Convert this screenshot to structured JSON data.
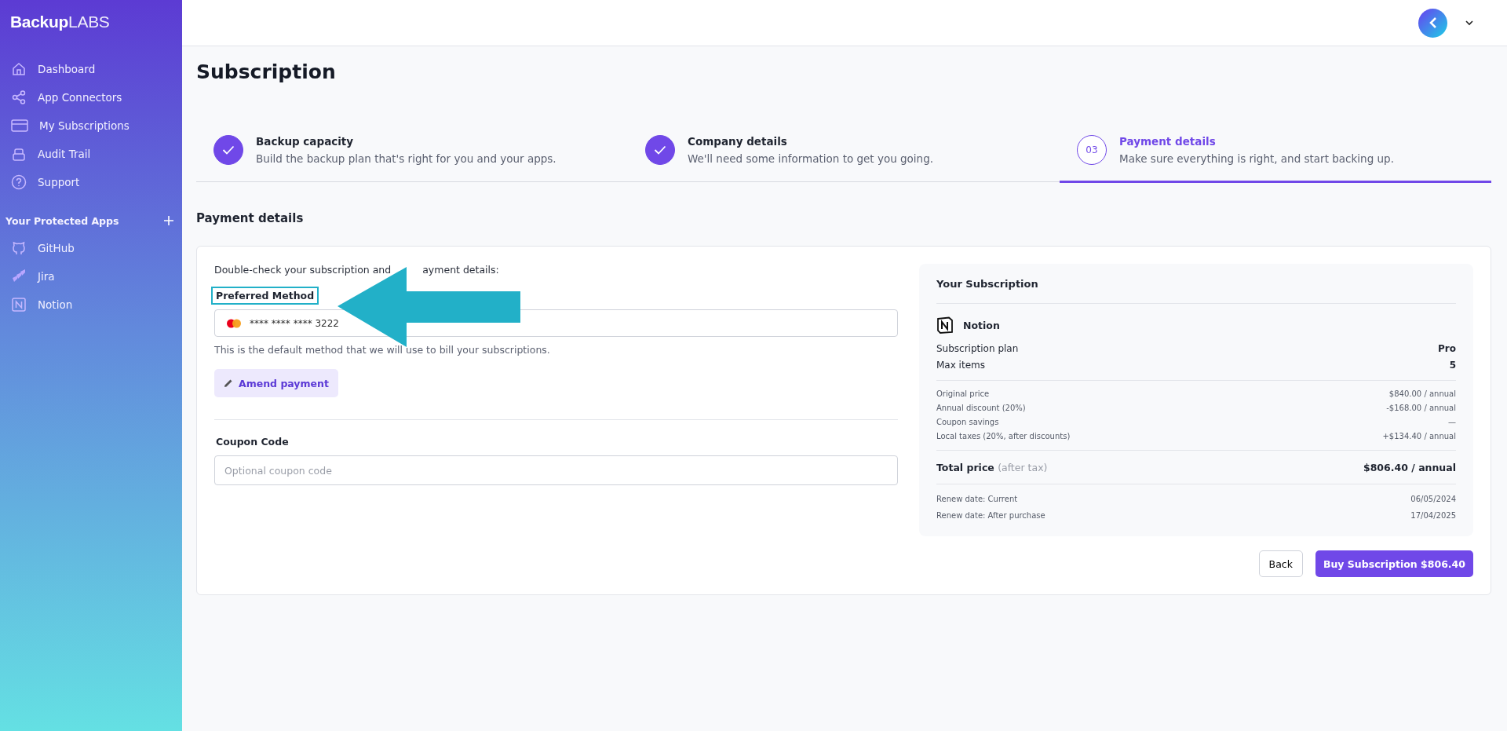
{
  "sidebar": {
    "logo_bold": "Backup",
    "logo_light": "LABS",
    "nav": [
      {
        "label": "Dashboard"
      },
      {
        "label": "App Connectors"
      },
      {
        "label": "My Subscriptions"
      },
      {
        "label": "Audit Trail"
      },
      {
        "label": "Support"
      }
    ],
    "apps_heading": "Your Protected Apps",
    "apps": [
      {
        "label": "GitHub"
      },
      {
        "label": "Jira"
      },
      {
        "label": "Notion"
      }
    ]
  },
  "page_title": "Subscription",
  "steps": [
    {
      "title": "Backup capacity",
      "description": "Build the backup plan that's right for you and your apps.",
      "done": true,
      "selected": false
    },
    {
      "title": "Company details",
      "description": "We'll need some information to get you going.",
      "done": true,
      "selected": false
    },
    {
      "number": "03",
      "title": "Payment details",
      "description": "Make sure everything is right, and start backing up.",
      "done": false,
      "selected": true
    }
  ],
  "section_title": "Payment details",
  "form": {
    "intro_before": "Double-check your subscription and",
    "intro_after": "ayment details:",
    "method_label": "Preferred Method",
    "method_highlighted": true,
    "card_value": "**** **** **** 3222",
    "method_help": "This is the default method that we will use to bill your subscriptions.",
    "amend_button": "Amend payment",
    "coupon_label": "Coupon Code",
    "coupon_placeholder": "Optional coupon code"
  },
  "summary": {
    "title": "Your Subscription",
    "app": "Notion",
    "plan_rows": [
      {
        "label": "Subscription plan",
        "value": "Pro"
      },
      {
        "label": "Max items",
        "value": "5"
      }
    ],
    "price_rows": [
      {
        "label": "Original price",
        "value": "$840.00 / annual"
      },
      {
        "label": "Annual discount (20%)",
        "value": "-$168.00 / annual"
      },
      {
        "label": "Coupon savings",
        "value": "—"
      },
      {
        "label": "Local taxes (20%, after discounts)",
        "value": "+$134.40 / annual"
      }
    ],
    "total_label": "Total price",
    "total_note": "(after tax)",
    "total_value": "$806.40 / annual",
    "date_rows": [
      {
        "label": "Renew date: Current",
        "value": "06/05/2024"
      },
      {
        "label": "Renew date: After purchase",
        "value": "17/04/2025"
      }
    ]
  },
  "buttons": {
    "back": "Back",
    "buy": "Buy Subscription $806.40"
  }
}
